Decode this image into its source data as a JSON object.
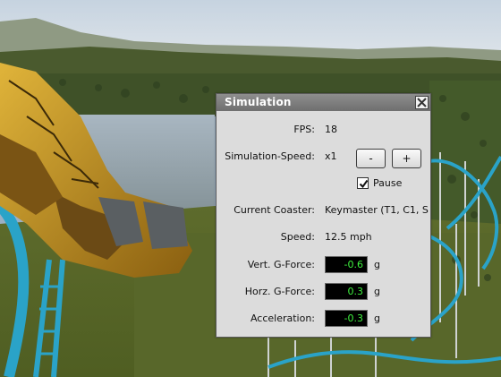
{
  "window": {
    "title": "Simulation"
  },
  "simulation": {
    "fps_label": "FPS:",
    "fps_value": "18",
    "speed_label": "Simulation-Speed:",
    "speed_value": "x1",
    "speed_decrease_label": "-",
    "speed_increase_label": "+",
    "pause_label": "Pause",
    "pause_checked": true,
    "coaster_label": "Current Coaster:",
    "coaster_value": "Keymaster (T1, C1, S",
    "speed_row_label": "Speed:",
    "speed_row_value": "12.5 mph",
    "vert_g_label": "Vert. G-Force:",
    "vert_g_value": "-0.6",
    "vert_g_unit": "g",
    "horz_g_label": "Horz. G-Force:",
    "horz_g_value": "0.3",
    "horz_g_unit": "g",
    "accel_label": "Acceleration:",
    "accel_value": "-0.3",
    "accel_unit": "g"
  },
  "colors": {
    "readout_text": "#3ef03e",
    "readout_bg": "#000000",
    "titlebar": "#7a7a7a",
    "panel": "#dcdcdc",
    "track": "#2aa3c8",
    "coaster_car": "#b8861c"
  }
}
